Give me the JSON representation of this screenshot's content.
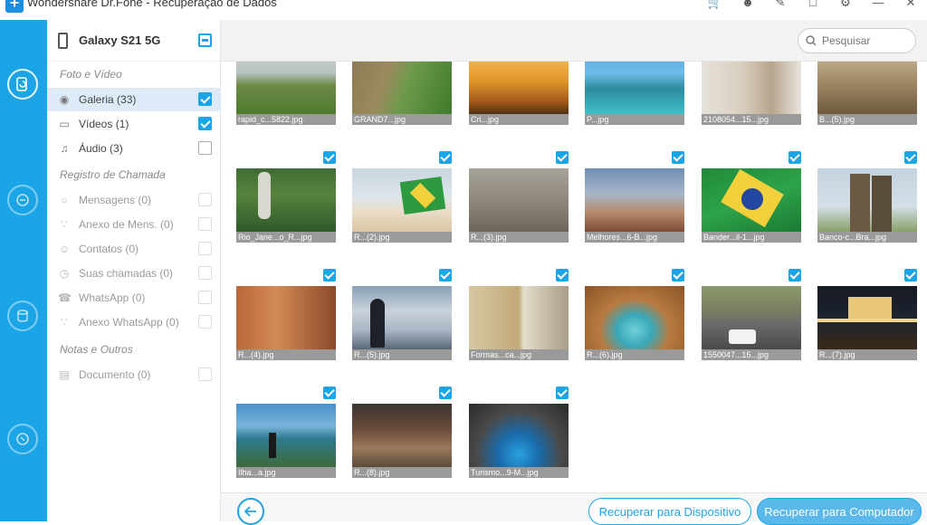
{
  "window": {
    "title": "Wondershare Dr.Fone - Recuperação de Dados"
  },
  "device": {
    "name": "Galaxy S21 5G"
  },
  "sidebar": {
    "sections": [
      {
        "title": "Foto e Vídeo"
      },
      {
        "title": "Registro de Chamada"
      },
      {
        "title": "Notas e Outros"
      }
    ],
    "items": [
      {
        "label": "Galeria (33)",
        "icon": "camera-icon",
        "checked": true,
        "enabled": true,
        "selected": true
      },
      {
        "label": "Vídeos (1)",
        "icon": "video-icon",
        "checked": true,
        "enabled": true
      },
      {
        "label": "Áudio (3)",
        "icon": "music-icon",
        "checked": false,
        "enabled": true
      },
      {
        "label": "Mensagens (0)",
        "icon": "message-icon",
        "checked": false,
        "enabled": false
      },
      {
        "label": "Anexo de Mens. (0)",
        "icon": "paperclip-icon",
        "checked": false,
        "enabled": false
      },
      {
        "label": "Contatos (0)",
        "icon": "person-icon",
        "checked": false,
        "enabled": false
      },
      {
        "label": "Suas chamadas (0)",
        "icon": "clock-icon",
        "checked": false,
        "enabled": false
      },
      {
        "label": "WhatsApp (0)",
        "icon": "whatsapp-icon",
        "checked": false,
        "enabled": false
      },
      {
        "label": "Anexo WhatsApp (0)",
        "icon": "paperclip-icon",
        "checked": false,
        "enabled": false
      },
      {
        "label": "Documento (0)",
        "icon": "document-icon",
        "checked": false,
        "enabled": false
      }
    ]
  },
  "search": {
    "placeholder": "Pesquisar"
  },
  "gallery": {
    "thumbnails": [
      {
        "caption": "rapid_c...5822.jpg"
      },
      {
        "caption": "GRAND7...jpg"
      },
      {
        "caption": "Cri...jpg"
      },
      {
        "caption": "P...jpg"
      },
      {
        "caption": "2108054...15...jpg"
      },
      {
        "caption": "B...(5).jpg"
      },
      {
        "caption": "Rio_Jane...o_R...jpg"
      },
      {
        "caption": "R...(2).jpg"
      },
      {
        "caption": "R...(3).jpg"
      },
      {
        "caption": "Melhores...6-B...jpg"
      },
      {
        "caption": "Bander...il-1...jpg"
      },
      {
        "caption": "Banco-c...Bra...jpg"
      },
      {
        "caption": "R...(4).jpg"
      },
      {
        "caption": "R...(5).jpg"
      },
      {
        "caption": "Formas...ca...jpg"
      },
      {
        "caption": "R...(6).jpg"
      },
      {
        "caption": "1550047...15...jpg"
      },
      {
        "caption": "R...(7).jpg"
      },
      {
        "caption": "Ilha...a.jpg"
      },
      {
        "caption": "R...(8).jpg"
      },
      {
        "caption": "Turismo...9-M...jpg"
      }
    ]
  },
  "footer": {
    "recover_device": "Recuperar para Dispositivo",
    "recover_computer": "Recuperar para Computador"
  },
  "colors": {
    "accent": "#1ba5e6",
    "selection": "#dcebf7"
  }
}
